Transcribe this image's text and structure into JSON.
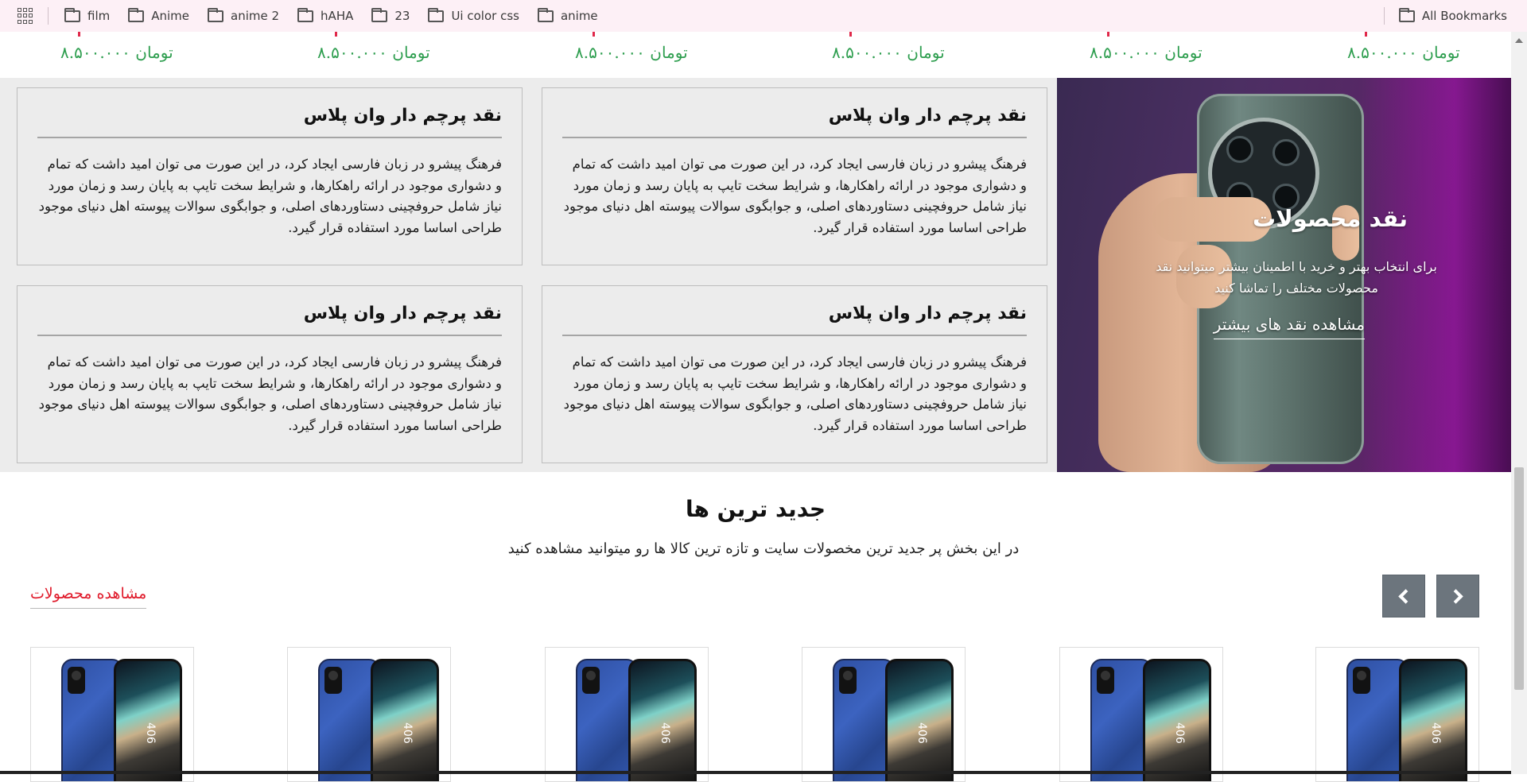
{
  "bookmarks": {
    "items": [
      {
        "label": "film"
      },
      {
        "label": "Anime"
      },
      {
        "label": "anime 2"
      },
      {
        "label": "hAHA"
      },
      {
        "label": "23"
      },
      {
        "label": "Ui color css"
      },
      {
        "label": "anime"
      }
    ],
    "all_label": "All Bookmarks"
  },
  "price_strip": {
    "prices": [
      "تومان ۸.۵۰۰.۰۰۰",
      "تومان ۸.۵۰۰.۰۰۰",
      "تومان ۸.۵۰۰.۰۰۰",
      "تومان ۸.۵۰۰.۰۰۰",
      "تومان ۸.۵۰۰.۰۰۰",
      "تومان ۸.۵۰۰.۰۰۰"
    ],
    "price_color": "#2e9e4f"
  },
  "reviews": {
    "cards": [
      {
        "title": "نقد پرچم دار وان پلاس",
        "text": "فرهنگ پیشرو در زبان فارسی ایجاد کرد، در این صورت می توان امید داشت که تمام و دشواری موجود در ارائه راهکارها، و شرایط سخت تایپ به پایان رسد و زمان مورد نیاز شامل حروفچینی دستاوردهای اصلی، و جوابگوی سوالات پیوسته اهل دنیای موجود طراحی اساسا مورد استفاده قرار گیرد."
      },
      {
        "title": "نقد پرچم دار وان پلاس",
        "text": "فرهنگ پیشرو در زبان فارسی ایجاد کرد، در این صورت می توان امید داشت که تمام و دشواری موجود در ارائه راهکارها، و شرایط سخت تایپ به پایان رسد و زمان مورد نیاز شامل حروفچینی دستاوردهای اصلی، و جوابگوی سوالات پیوسته اهل دنیای موجود طراحی اساسا مورد استفاده قرار گیرد."
      },
      {
        "title": "نقد پرچم دار وان پلاس",
        "text": "فرهنگ پیشرو در زبان فارسی ایجاد کرد، در این صورت می توان امید داشت که تمام و دشواری موجود در ارائه راهکارها، و شرایط سخت تایپ به پایان رسد و زمان مورد نیاز شامل حروفچینی دستاوردهای اصلی، و جوابگوی سوالات پیوسته اهل دنیای موجود طراحی اساسا مورد استفاده قرار گیرد."
      },
      {
        "title": "نقد پرچم دار وان پلاس",
        "text": "فرهنگ پیشرو در زبان فارسی ایجاد کرد، در این صورت می توان امید داشت که تمام و دشواری موجود در ارائه راهکارها، و شرایط سخت تایپ به پایان رسد و زمان مورد نیاز شامل حروفچینی دستاوردهای اصلی، و جوابگوی سوالات پیوسته اهل دنیای موجود طراحی اساسا مورد استفاده قرار گیرد."
      }
    ],
    "hero": {
      "title": "نقد محصولات",
      "description": "برای انتخاب بهتر و خرید با اطمینان بیشتر میتوانید نقد محصولات مختلف را تماشا کنید",
      "link": "مشاهده نقد های بیشتر"
    }
  },
  "newest": {
    "title": "جدید ترین ها",
    "subtitle": "در این بخش پر جدید ترین مخصولات سایت و تازه ترین کالا ها رو میتوانید مشاهده کنید",
    "view_products": "مشاهده محصولات",
    "product_image_label": "406"
  },
  "colors": {
    "link_red": "#e01b2b",
    "arrow_button": "#6c757d",
    "section_bg": "#ececec"
  }
}
